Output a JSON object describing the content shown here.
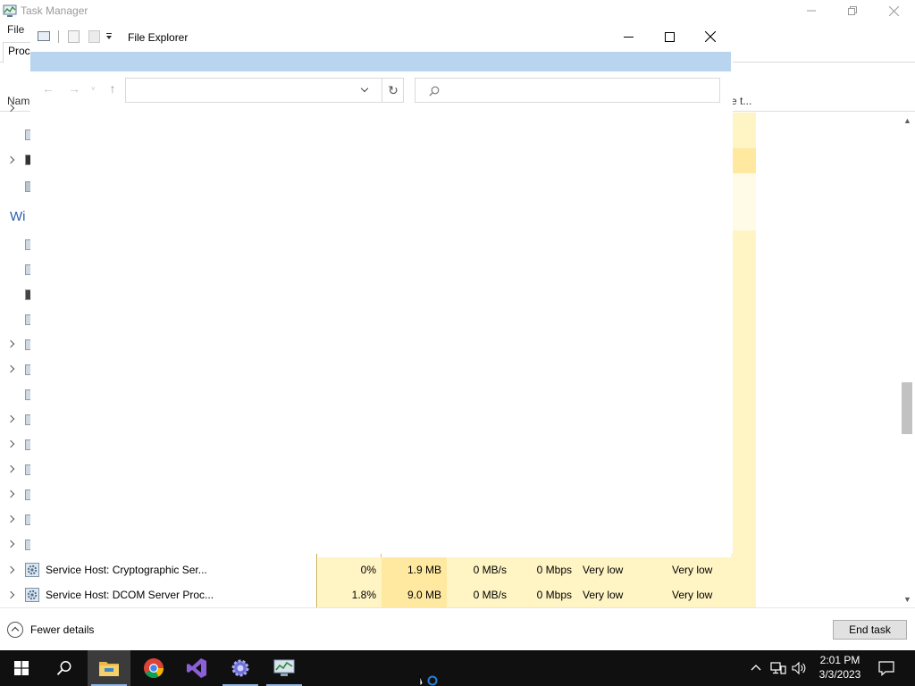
{
  "task_manager": {
    "title": "Task Manager",
    "menu": {
      "file": "File"
    },
    "tabs": {
      "processes_truncated": "Proc"
    },
    "columns": {
      "name_truncated": "Nam",
      "last_truncated": "e t..."
    },
    "group_label_truncated": "Wi",
    "rows": [
      {
        "name": "Service Host: Cryptographic Ser...",
        "cpu": "0%",
        "memory": "1.9 MB",
        "disk": "0 MB/s",
        "network": "0 Mbps",
        "power_usage": "Very low",
        "power_trend": "Very low"
      },
      {
        "name": "Service Host: DCOM Server Proc...",
        "cpu": "1.8%",
        "memory": "9.0 MB",
        "disk": "0 MB/s",
        "network": "0 Mbps",
        "power_usage": "Very low",
        "power_trend": "Very low"
      }
    ],
    "footer": {
      "fewer_details": "Fewer details",
      "end_task": "End task"
    }
  },
  "file_explorer": {
    "title": "File Explorer",
    "address_value": "",
    "search_placeholder": ""
  },
  "taskbar": {
    "pinned": [
      "windows-start",
      "search",
      "file-explorer",
      "google-chrome",
      "visual-studio",
      "settings-gear-app",
      "task-manager"
    ],
    "clock": {
      "time": "2:01 PM",
      "date": "3/3/2023"
    }
  },
  "colors": {
    "ribbon_blue": "#b8d4ee",
    "column_heat_light": "#fff4c4",
    "column_heat_medium": "#ffe8a0",
    "group_header_blue": "#2a5ea8",
    "taskbar": "#101010"
  }
}
